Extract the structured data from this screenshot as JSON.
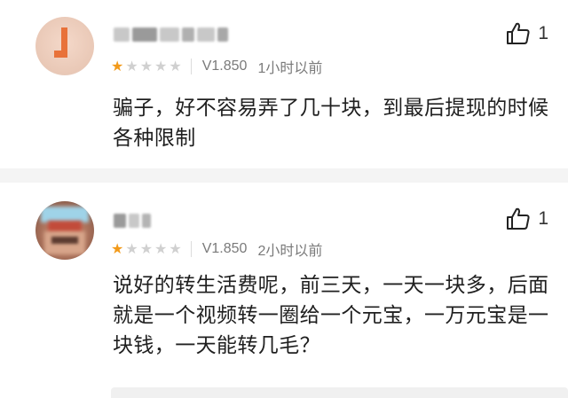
{
  "reviews": [
    {
      "version": "V1.850",
      "time": "1小时以前",
      "rating": 1,
      "rating_max": 5,
      "likes": "1",
      "content": "骗子，好不容易弄了几十块，到最后提现的时候各种限制"
    },
    {
      "version": "V1.850",
      "time": "2小时以前",
      "rating": 1,
      "rating_max": 5,
      "likes": "1",
      "content": "说好的转生活费呢，前三天，一天一块多，后面就是一个视频转一圈给一个元宝，一万元宝是一块钱，一天能转几毛？"
    }
  ],
  "colors": {
    "star_on": "#f29a1a",
    "star_off": "#d0d0d0",
    "meta_text": "#7a7a7a"
  },
  "icons": {
    "like": "thumbs-up-icon",
    "star": "star-icon"
  }
}
